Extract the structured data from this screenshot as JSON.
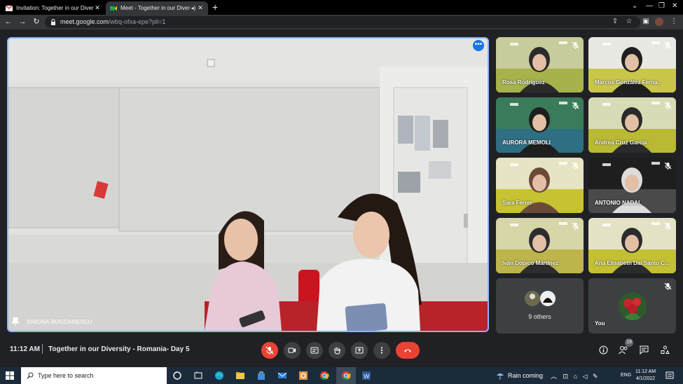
{
  "browser": {
    "tabs": [
      {
        "title": "Invitation: Together in our Divers",
        "favicon": "gmail-icon",
        "active": false
      },
      {
        "title": "Meet - Together in our Divers",
        "favicon": "meet-icon",
        "active": true
      }
    ],
    "url_host": "meet.google.com",
    "url_path": "/wbq-ofxa-epe?pli=1"
  },
  "main_video": {
    "participant": "SIMONA BOGDANESCU"
  },
  "participants": [
    {
      "name": "Rosa Rodríguez",
      "muted": true
    },
    {
      "name": "Marcos González Ferna...",
      "muted": true
    },
    {
      "name": "AURORA MEMOLI",
      "muted": true
    },
    {
      "name": "Andrea Cruz García",
      "muted": true
    },
    {
      "name": "Sara Ferrer",
      "muted": true
    },
    {
      "name": "ANTONIO NADAL",
      "muted": true
    },
    {
      "name": "Iván Dopico Martínez",
      "muted": true
    },
    {
      "name": "Ana Elisabeth Dal Santo C...",
      "muted": true
    }
  ],
  "others": {
    "label": "9 others"
  },
  "self_tile": {
    "label": "You"
  },
  "meeting": {
    "time": "11:12 AM",
    "title": "Together in our Diversity - Romania- Day 5",
    "participant_count": "19"
  },
  "taskbar": {
    "search_placeholder": "Type here to search",
    "weather": "Rain coming",
    "language": "ENG",
    "time": "11:12 AM",
    "date": "4/1/2022"
  },
  "colors": {
    "end_call": "#ea4335",
    "accent": "#8ab4f8",
    "background": "#202124"
  }
}
